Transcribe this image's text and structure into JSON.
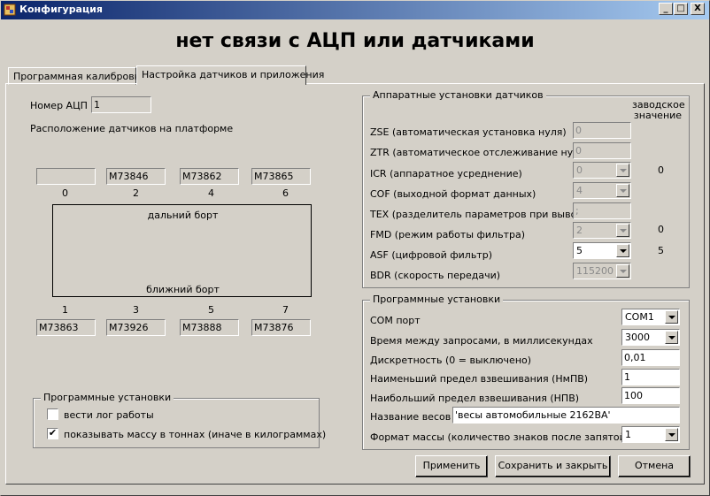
{
  "window": {
    "title": "Конфигурация",
    "minimize": "_",
    "maximize": "□",
    "close": "X"
  },
  "heading": "нет связи с АЦП или датчиками",
  "tabs": [
    {
      "label": "Программная калибровка"
    },
    {
      "label": "Настройка датчиков и приложения"
    }
  ],
  "adc": {
    "label": "Номер АЦП",
    "value": "1"
  },
  "sensors": {
    "layout_label": "Расположение датчиков на платформе",
    "far_side": "дальний борт",
    "near_side": "ближний борт",
    "top": [
      {
        "index": "0",
        "value": ""
      },
      {
        "index": "2",
        "value": "M73846"
      },
      {
        "index": "4",
        "value": "M73862"
      },
      {
        "index": "6",
        "value": "M73865"
      }
    ],
    "bottom": [
      {
        "index": "1",
        "value": "M73863"
      },
      {
        "index": "3",
        "value": "M73926"
      },
      {
        "index": "5",
        "value": "M73888"
      },
      {
        "index": "7",
        "value": "M73876"
      }
    ]
  },
  "app_settings_left": {
    "title": "Программные установки",
    "log": {
      "label": "вести лог работы",
      "checked": false
    },
    "tons": {
      "label": "показывать массу в тоннах (иначе в килограммах)",
      "checked": true,
      "mark": "✔"
    }
  },
  "hardware": {
    "title": "Аппаратные установки датчиков",
    "factory_header": "заводское значение",
    "rows": [
      {
        "label": "ZSE (автоматическая установка нуля)",
        "value": "0",
        "factory": ""
      },
      {
        "label": "ZTR (автоматическое отслеживание нуля)",
        "value": "0",
        "factory": ""
      },
      {
        "label": "ICR (аппаратное усреднение)",
        "value": "0",
        "factory": "0"
      },
      {
        "label": "COF (выходной формат данных)",
        "value": "4",
        "factory": ""
      },
      {
        "label": "TEX (разделитель параметров при выводе)",
        "value": ";",
        "factory": ""
      },
      {
        "label": "FMD (режим работы фильтра)",
        "value": "2",
        "factory": "0"
      },
      {
        "label": "ASF (цифровой фильтр)",
        "value": "5",
        "factory": "5"
      },
      {
        "label": "BDR (скорость передачи)",
        "value": "115200",
        "factory": ""
      }
    ]
  },
  "software": {
    "title": "Программные установки",
    "com_label": "COM порт",
    "com_value": "COM1",
    "interval_label": "Время между запросами, в миллисекундах",
    "interval_value": "3000",
    "discrete_label": "Дискретность (0 = выключено)",
    "discrete_value": "0,01",
    "min_label": "Наименьший предел взвешивания (НмПВ)",
    "min_value": "1",
    "max_label": "Наибольший предел взвешивания (НПВ)",
    "max_value": "100",
    "name_label": "Название весов",
    "name_value": "'весы автомобильные 2162ВА'",
    "format_label": "Формат массы (количество знаков после запятой)",
    "format_value": "1"
  },
  "buttons": {
    "apply": "Применить",
    "save_close": "Сохранить и закрыть",
    "cancel": "Отмена"
  }
}
